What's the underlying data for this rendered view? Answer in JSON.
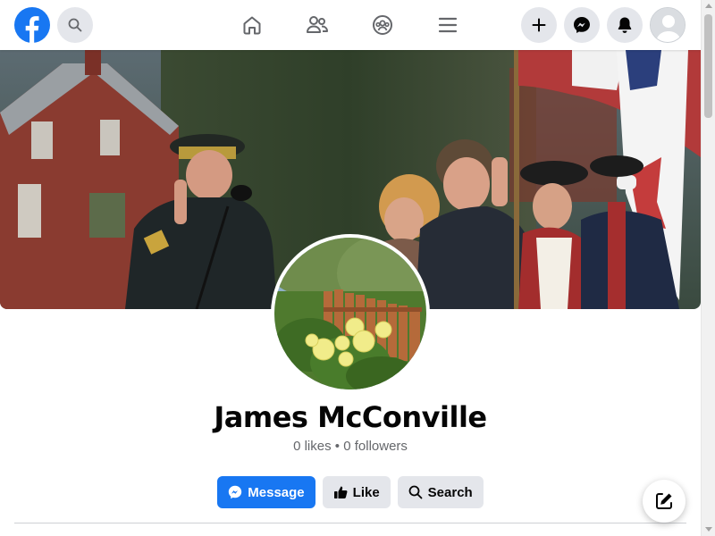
{
  "header": {
    "brand": "facebook-logo",
    "icons": [
      "search-icon",
      "home-icon",
      "friends-icon",
      "groups-icon",
      "menu-icon",
      "plus-icon",
      "messenger-icon",
      "bell-icon",
      "avatar"
    ],
    "accent_color": "#1877f2"
  },
  "profile": {
    "name": "James McConville",
    "likes": "0 likes",
    "separator": "•",
    "followers": "0 followers"
  },
  "actions": {
    "message_label": "Message",
    "like_label": "Like",
    "search_label": "Search"
  }
}
